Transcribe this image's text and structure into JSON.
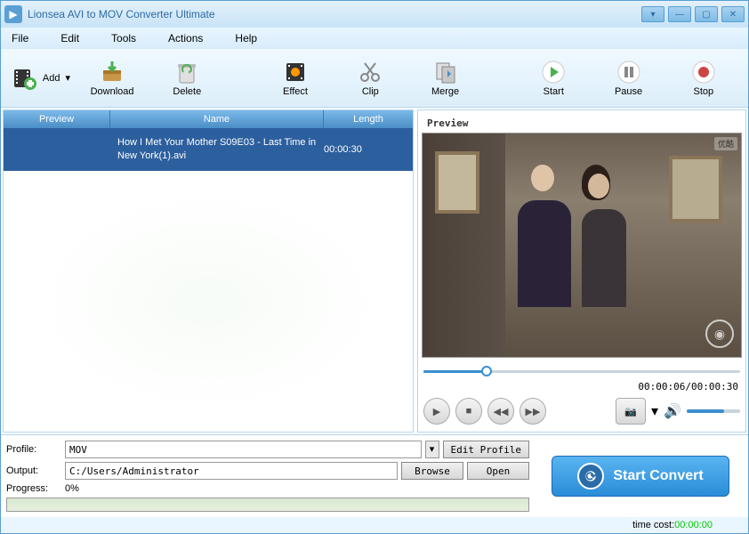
{
  "titlebar": {
    "title": "Lionsea AVI to MOV Converter Ultimate"
  },
  "menu": {
    "file": "File",
    "edit": "Edit",
    "tools": "Tools",
    "actions": "Actions",
    "help": "Help"
  },
  "toolbar": {
    "add": "Add",
    "download": "Download",
    "delete": "Delete",
    "effect": "Effect",
    "clip": "Clip",
    "merge": "Merge",
    "start": "Start",
    "pause": "Pause",
    "stop": "Stop"
  },
  "list": {
    "headers": {
      "preview": "Preview",
      "name": "Name",
      "length": "Length"
    },
    "rows": [
      {
        "name": "How I Met Your Mother S09E03 - Last Time in New York(1).avi",
        "length": "00:00:30"
      }
    ]
  },
  "preview": {
    "title": "Preview",
    "time": "00:00:06/00:00:30",
    "watermark": "优酷"
  },
  "settings": {
    "profile_label": "Profile:",
    "profile_value": "MOV",
    "edit_profile": "Edit Profile",
    "output_label": "Output:",
    "output_value": "C:/Users/Administrator",
    "browse": "Browse",
    "open": "Open",
    "progress_label": "Progress:",
    "progress_value": "0%"
  },
  "convert": {
    "label": "Start Convert"
  },
  "footer": {
    "time_cost_label": "time cost:",
    "time_cost_value": "00:00:00"
  }
}
